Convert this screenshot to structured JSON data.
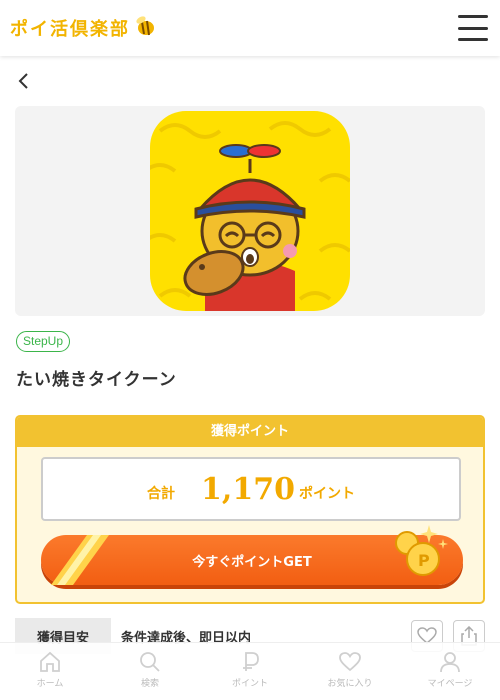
{
  "header": {
    "logo_text": "ポイ活倶楽部",
    "menu_icon": "hamburger-menu-icon",
    "brand_color": "#f2b400"
  },
  "nav": {
    "back_icon": "chevron-left-icon"
  },
  "offer": {
    "tag": "StepUp",
    "title": "たい焼きタイクーン"
  },
  "points": {
    "header": "獲得ポイント",
    "total_label": "合計",
    "total_value": "1,170",
    "unit": "ポイント",
    "cta": "今すぐポイントGET",
    "accent_color": "#f2c230",
    "cta_color": "#f25e12"
  },
  "estimate": {
    "label": "獲得目安",
    "value": "条件達成後、即日以内"
  },
  "actions": {
    "favorite_icon": "heart-icon",
    "share_icon": "share-icon"
  },
  "tabs": [
    {
      "label": "ホーム",
      "icon": "home-icon"
    },
    {
      "label": "検索",
      "icon": "search-icon"
    },
    {
      "label": "ポイント",
      "icon": "point-icon"
    },
    {
      "label": "お気に入り",
      "icon": "heart-icon"
    },
    {
      "label": "マイページ",
      "icon": "user-icon"
    }
  ]
}
